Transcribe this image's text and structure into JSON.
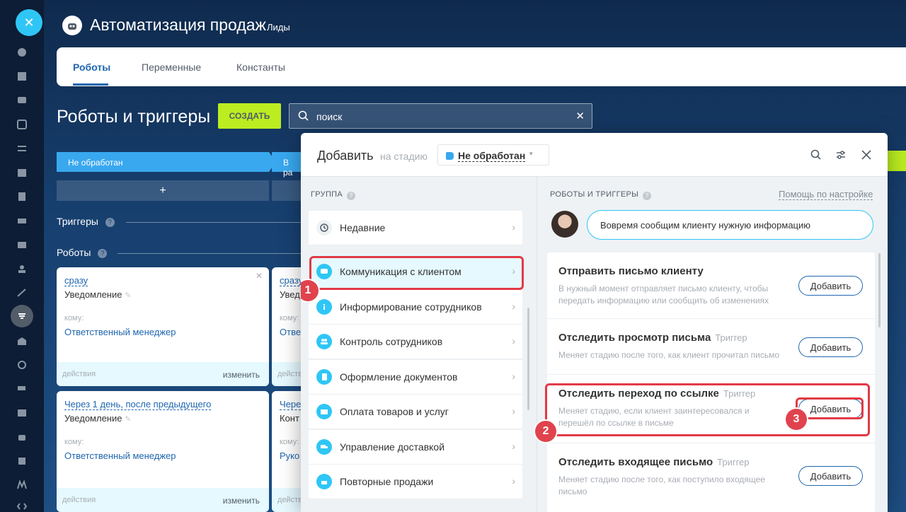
{
  "app": {
    "title": "Автоматизация продаж",
    "subtitle": "Лиды"
  },
  "tabs": [
    {
      "label": "Роботы"
    },
    {
      "label": "Переменные"
    },
    {
      "label": "Константы"
    }
  ],
  "page": {
    "title": "Роботы и триггеры",
    "create_label": "СОЗДАТЬ",
    "search_placeholder": "поиск"
  },
  "stages": [
    {
      "label": "Не обработан"
    },
    {
      "label": "В ра"
    }
  ],
  "add_col": "+",
  "sections": {
    "triggers": "Триггеры",
    "robots": "Роботы",
    "help_glyph": "?"
  },
  "cards": [
    {
      "when": "сразу",
      "kind": "Уведомление",
      "to": "кому:",
      "who": "Ответственный менеджер",
      "actions": "действия",
      "edit": "изменить"
    },
    {
      "when": "сразу",
      "kind": "Увед",
      "to": "кому:",
      "who": "Отве",
      "actions": "действия",
      "edit": ""
    },
    {
      "when": "Через 1 день, после предыдущего",
      "kind": "Уведомление",
      "to": "кому:",
      "who": "Ответственный менеджер",
      "actions": "действия",
      "edit": "изменить"
    },
    {
      "when": "Чере",
      "kind": "Конт",
      "to": "кому:",
      "who": "Руко",
      "actions": "действия",
      "edit": ""
    }
  ],
  "dialog": {
    "title": "Добавить",
    "at_stage": "на стадию",
    "stage": "Не обработан",
    "group_label": "ГРУППА",
    "robots_label": "РОБОТЫ И ТРИГГЕРЫ",
    "help_link": "Помощь по настройке",
    "chat_text": "Вовремя сообщим клиенту нужную информацию",
    "groups": [
      {
        "label": "Недавние",
        "icon": "history-icon",
        "color": "#eef2f4"
      },
      {
        "label": "Коммуникация с клиентом",
        "icon": "chat-icon",
        "color": "#2fc6f6"
      },
      {
        "label": "Информирование сотрудников",
        "icon": "info-icon",
        "color": "#2fc6f6"
      },
      {
        "label": "Контроль сотрудников",
        "icon": "people-icon",
        "color": "#2fc6f6"
      },
      {
        "label": "Оформление документов",
        "icon": "document-icon",
        "color": "#2fc6f6"
      },
      {
        "label": "Оплата товаров и услуг",
        "icon": "wallet-icon",
        "color": "#2fc6f6"
      },
      {
        "label": "Управление доставкой",
        "icon": "truck-icon",
        "color": "#2fc6f6"
      },
      {
        "label": "Повторные продажи",
        "icon": "register-icon",
        "color": "#2fc6f6"
      }
    ],
    "robots": [
      {
        "title": "Отправить письмо клиенту",
        "tag": "",
        "desc": "В нужный момент отправляет письмо клиенту, чтобы передать информацию или сообщить об изменениях",
        "btn": "Добавить"
      },
      {
        "title": "Отследить просмотр письма",
        "tag": "Триггер",
        "desc": "Меняет стадию после того, как клиент прочитал письмо",
        "btn": "Добавить"
      },
      {
        "title": "Отследить переход по ссылке",
        "tag": "Триггер",
        "desc": "Меняет стадию, если клиент заинтересовался и перешёл по ссылке в письме",
        "btn": "Добавить"
      },
      {
        "title": "Отследить входящее письмо",
        "tag": "Триггер",
        "desc": "Меняет стадию после того, как поступило входящее письмо",
        "btn": "Добавить"
      }
    ]
  },
  "markers": [
    "1",
    "2",
    "3"
  ],
  "colors": {
    "accent": "#2067b0",
    "create": "#bbed21",
    "stage": "#39a8ef",
    "highlight": "#e23a46"
  }
}
